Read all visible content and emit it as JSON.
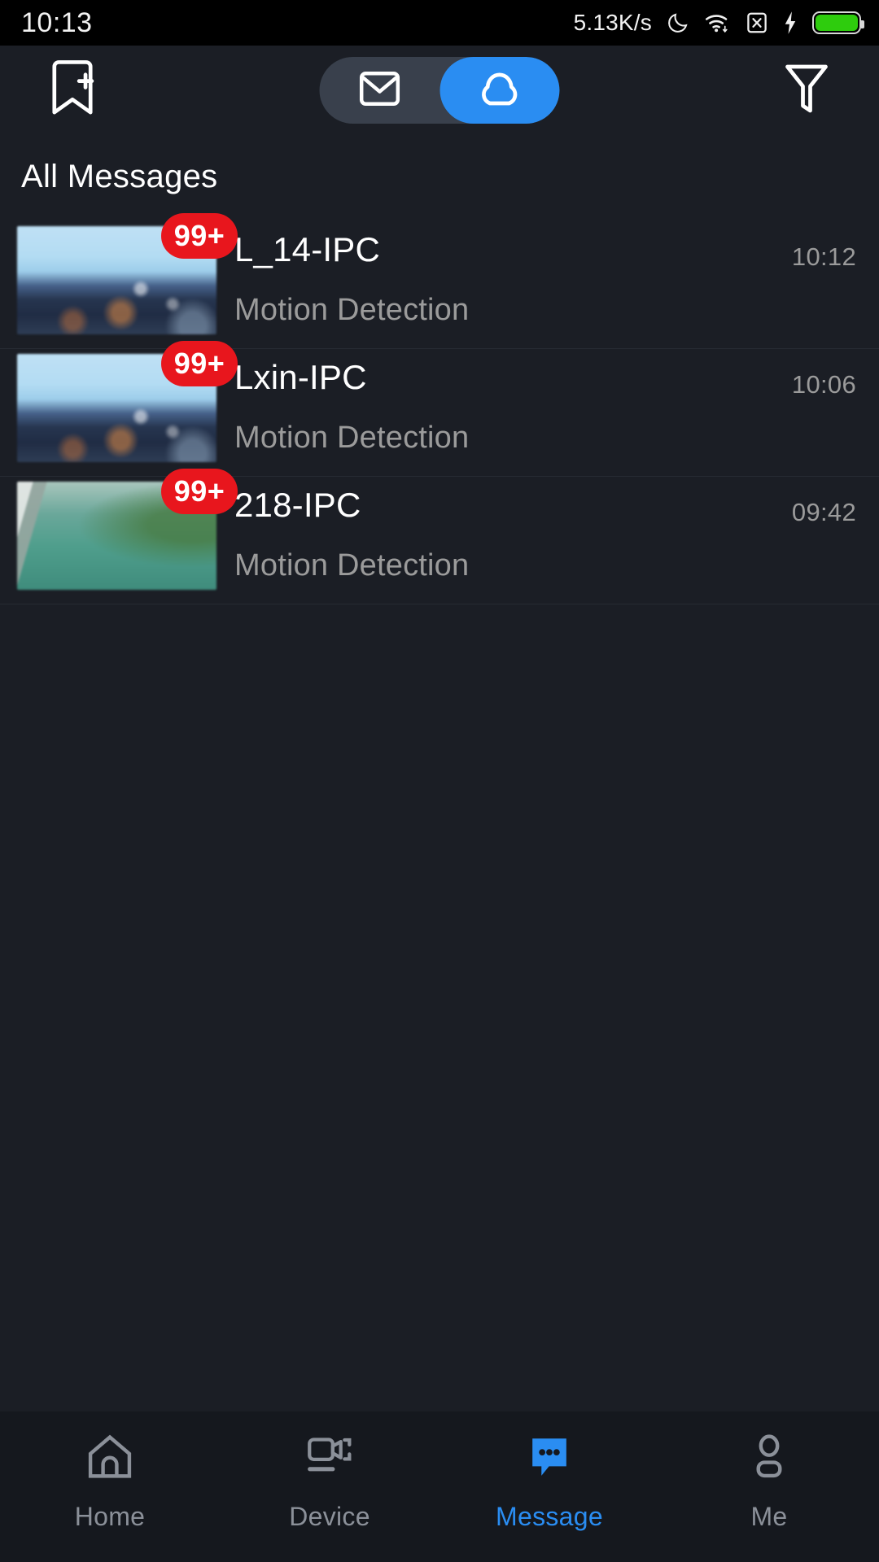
{
  "status_bar": {
    "clock": "10:13",
    "network_speed": "5.13K/s",
    "icons": [
      "moon-icon",
      "wifi-icon",
      "sim-disabled-icon",
      "charging-bolt-icon",
      "battery-icon"
    ],
    "battery_color": "#2ecc0d"
  },
  "toolbar": {
    "left_icon": "bookmark-add-icon",
    "right_icon": "filter-funnel-icon",
    "segmented": {
      "options": [
        {
          "name": "mail-icon",
          "active": false
        },
        {
          "name": "cloud-icon",
          "active": true
        }
      ],
      "active_color": "#2a8df2",
      "track_color": "#39404c"
    }
  },
  "content": {
    "section_title": "All Messages",
    "messages": [
      {
        "title": "L_14-IPC",
        "subtitle": "Motion Detection",
        "time": "10:12",
        "badge": "99+",
        "thumbnail": "city-skyline"
      },
      {
        "title": "Lxin-IPC",
        "subtitle": "Motion Detection",
        "time": "10:06",
        "badge": "99+",
        "thumbnail": "city-skyline"
      },
      {
        "title": "218-IPC",
        "subtitle": "Motion Detection",
        "time": "09:42",
        "badge": "99+",
        "thumbnail": "green-wall"
      }
    ],
    "badge_color": "#e8161d"
  },
  "bottom_nav": {
    "active_color": "#2a8df2",
    "inactive_color": "#8b9099",
    "items": [
      {
        "label": "Home",
        "icon": "home-icon",
        "active": false
      },
      {
        "label": "Device",
        "icon": "camera-icon",
        "active": false
      },
      {
        "label": "Message",
        "icon": "message-icon",
        "active": true
      },
      {
        "label": "Me",
        "icon": "person-icon",
        "active": false
      }
    ]
  }
}
